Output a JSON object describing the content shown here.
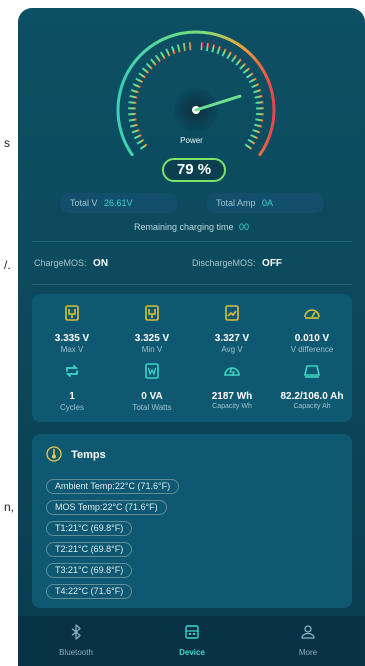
{
  "edge_fragments": [
    "s",
    "/.",
    "n,"
  ],
  "gauge": {
    "label": "Power",
    "percent_text": "79 %",
    "value_fraction": 0.79
  },
  "totals": {
    "total_v_label": "Total V",
    "total_v_value": "26.61V",
    "total_amp_label": "Total Amp",
    "total_amp_value": "0A"
  },
  "remaining": {
    "label": "Remaining charging time",
    "value": "00"
  },
  "mos": {
    "charge_label": "ChargeMOS:",
    "charge_value": "ON",
    "discharge_label": "DischargeMOS:",
    "discharge_value": "OFF"
  },
  "stats": [
    {
      "icon": "battery-max-icon",
      "value": "3.335 V",
      "label": "Max V"
    },
    {
      "icon": "battery-min-icon",
      "value": "3.325 V",
      "label": "Min V"
    },
    {
      "icon": "battery-avg-icon",
      "value": "3.327 V",
      "label": "Avg V"
    },
    {
      "icon": "speedometer-icon",
      "value": "0.010 V",
      "label": "V difference"
    },
    {
      "icon": "cycles-icon",
      "value": "1",
      "label": "Cycles"
    },
    {
      "icon": "watts-icon",
      "value": "0 VA",
      "label": "Total Watts"
    },
    {
      "icon": "capacity-wh-icon",
      "value": "2187 Wh",
      "label": "Capacity Wh"
    },
    {
      "icon": "capacity-ah-icon",
      "value": "82.2/106.0 Ah",
      "label": "Capacity Ah"
    }
  ],
  "temps": {
    "title": "Temps",
    "items": [
      "Ambient Temp:22°C (71.6°F)",
      "MOS Temp:22°C (71.6°F)",
      "T1:21°C (69.8°F)",
      "T2:21°C (69.8°F)",
      "T3:21°C (69.8°F)",
      "T4:22°C (71.6°F)"
    ]
  },
  "tabs": [
    {
      "label": "Bluetooth",
      "icon": "bluetooth-icon",
      "active": false
    },
    {
      "label": "Device",
      "icon": "device-icon",
      "active": true
    },
    {
      "label": "More",
      "icon": "user-icon",
      "active": false
    }
  ],
  "colors": {
    "accent": "#3fd6c8",
    "green": "#7de36b",
    "panel": "#0f5871",
    "background": "#0c4a5d"
  }
}
